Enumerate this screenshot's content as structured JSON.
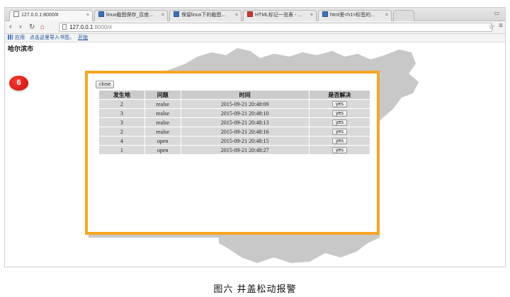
{
  "browser": {
    "tabs": [
      {
        "title": "127.0.0.1:8000/#",
        "favicon": "page-icon"
      },
      {
        "title": "linux截图保存_百度...",
        "favicon": "baidu-icon"
      },
      {
        "title": "保留linux下的截图...",
        "favicon": "baidu-icon"
      },
      {
        "title": "HTML标记一览表 - ...",
        "favicon": "csdn-icon"
      },
      {
        "title": "html里<h1>标签的...",
        "favicon": "baidu-icon"
      }
    ],
    "url_host": "127.0.0.1",
    "url_rest": ":8000/#",
    "bookmarks": {
      "apps_label": "应用",
      "hint": "点击这里导入书签。",
      "start_link": "开始"
    }
  },
  "page": {
    "city_title": "哈尔滨市",
    "badge_count": "6"
  },
  "modal": {
    "close_label": "close",
    "columns": [
      "发生地",
      "问题",
      "时间",
      "是否解决"
    ],
    "rows": [
      {
        "place": "2",
        "problem": "realse",
        "time": "2015-09-21 20:48:09",
        "action": "yes"
      },
      {
        "place": "3",
        "problem": "realse",
        "time": "2015-09-21 20:48:10",
        "action": "yes"
      },
      {
        "place": "3",
        "problem": "realse",
        "time": "2015-09-21 20:48:13",
        "action": "yes"
      },
      {
        "place": "2",
        "problem": "realse",
        "time": "2015-09-21 20:48:16",
        "action": "yes"
      },
      {
        "place": "4",
        "problem": "open",
        "time": "2015-09-21 20:48:15",
        "action": "yes"
      },
      {
        "place": "1",
        "problem": "open",
        "time": "2015-09-21 20:48:27",
        "action": "yes"
      }
    ]
  },
  "caption": "图六  井盖松动报警",
  "colors": {
    "modal_border": "#f5a623",
    "badge": "#e0140c",
    "map_fill": "#c8c8c8"
  }
}
